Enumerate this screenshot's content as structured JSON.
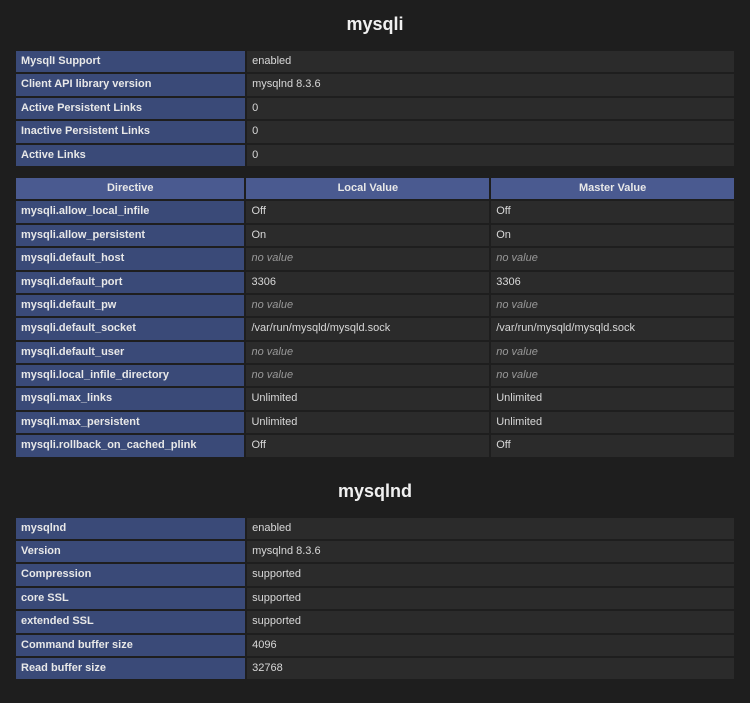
{
  "sections": [
    {
      "title": "mysqli",
      "info_rows": [
        {
          "key": "MysqlI Support",
          "val": "enabled"
        },
        {
          "key": "Client API library version",
          "val": "mysqlnd 8.3.6"
        },
        {
          "key": "Active Persistent Links",
          "val": "0"
        },
        {
          "key": "Inactive Persistent Links",
          "val": "0"
        },
        {
          "key": "Active Links",
          "val": "0"
        }
      ],
      "directive_headers": {
        "directive": "Directive",
        "local": "Local Value",
        "master": "Master Value"
      },
      "directive_rows": [
        {
          "key": "mysqli.allow_local_infile",
          "local": "Off",
          "master": "Off"
        },
        {
          "key": "mysqli.allow_persistent",
          "local": "On",
          "master": "On"
        },
        {
          "key": "mysqli.default_host",
          "local": "no value",
          "master": "no value",
          "novalue": true
        },
        {
          "key": "mysqli.default_port",
          "local": "3306",
          "master": "3306"
        },
        {
          "key": "mysqli.default_pw",
          "local": "no value",
          "master": "no value",
          "novalue": true
        },
        {
          "key": "mysqli.default_socket",
          "local": "/var/run/mysqld/mysqld.sock",
          "master": "/var/run/mysqld/mysqld.sock"
        },
        {
          "key": "mysqli.default_user",
          "local": "no value",
          "master": "no value",
          "novalue": true
        },
        {
          "key": "mysqli.local_infile_directory",
          "local": "no value",
          "master": "no value",
          "novalue": true
        },
        {
          "key": "mysqli.max_links",
          "local": "Unlimited",
          "master": "Unlimited"
        },
        {
          "key": "mysqli.max_persistent",
          "local": "Unlimited",
          "master": "Unlimited"
        },
        {
          "key": "mysqli.rollback_on_cached_plink",
          "local": "Off",
          "master": "Off"
        }
      ]
    },
    {
      "title": "mysqlnd",
      "info_rows": [
        {
          "key": "mysqlnd",
          "val": "enabled"
        },
        {
          "key": "Version",
          "val": "mysqlnd 8.3.6"
        },
        {
          "key": "Compression",
          "val": "supported"
        },
        {
          "key": "core SSL",
          "val": "supported"
        },
        {
          "key": "extended SSL",
          "val": "supported"
        },
        {
          "key": "Command buffer size",
          "val": "4096"
        },
        {
          "key": "Read buffer size",
          "val": "32768"
        }
      ]
    }
  ]
}
